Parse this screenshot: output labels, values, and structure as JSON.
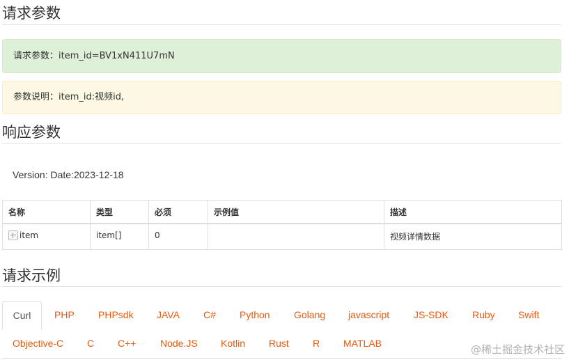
{
  "sections": {
    "request_title": "请求参数",
    "response_title": "响应参数",
    "example_title": "请求示例"
  },
  "alerts": {
    "request_params": "请求参数：item_id=BV1xN411U7mN",
    "param_desc": "参数说明：item_id:视频id,"
  },
  "version": "Version: Date:2023-12-18",
  "table": {
    "headers": [
      "名称",
      "类型",
      "必须",
      "示例值",
      "描述"
    ],
    "rows": [
      {
        "name": "item",
        "type": "item[]",
        "required": "0",
        "example": "",
        "desc": "视频详情数据"
      }
    ]
  },
  "tabs": {
    "row1": [
      "Curl",
      "PHP",
      "PHPsdk",
      "JAVA",
      "C#",
      "Python",
      "Golang",
      "javascript",
      "JS-SDK",
      "Ruby",
      "Swift"
    ],
    "row2": [
      "Objective-C",
      "C",
      "C++",
      "Node.JS",
      "Kotlin",
      "Rust",
      "R",
      "MATLAB"
    ],
    "active": "Curl"
  },
  "watermark": "@稀土掘金技术社区",
  "colors": {
    "tab_link": "#e8590c",
    "success_bg": "#dff0d8",
    "warning_bg": "#fcf8e3"
  }
}
